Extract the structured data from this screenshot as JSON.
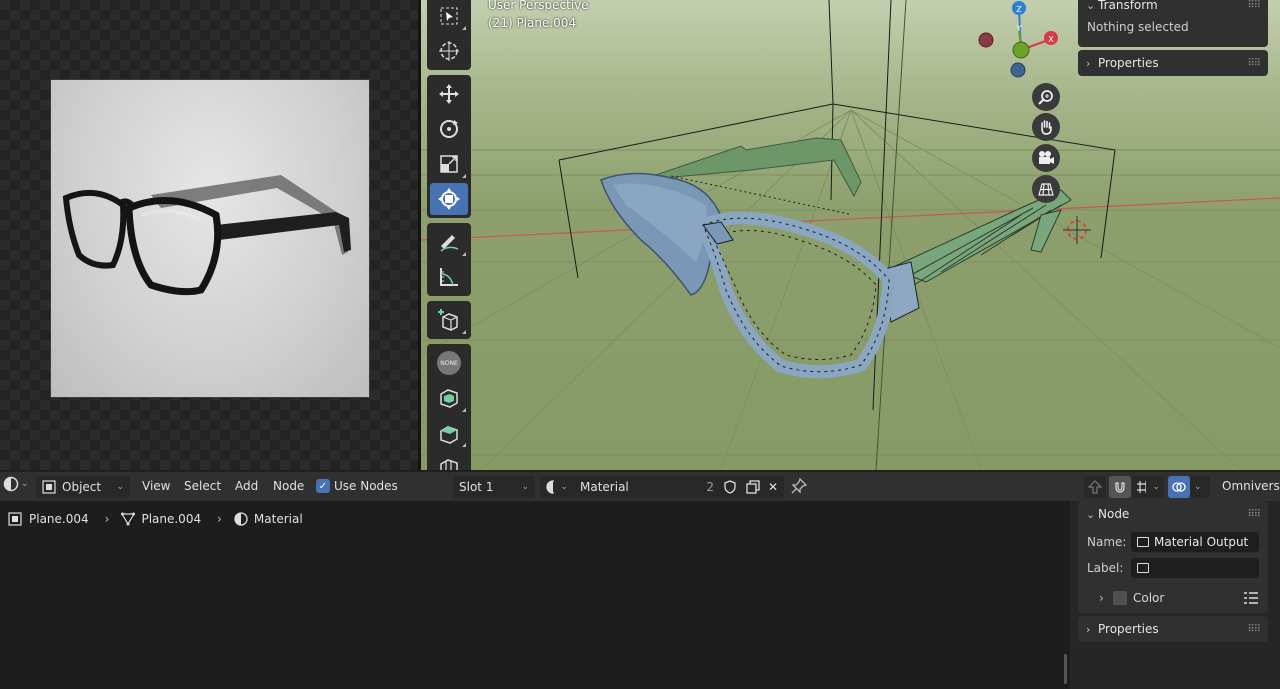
{
  "colors": {
    "accent": "#4772b3",
    "viewport_bg": "#869a66",
    "selected_mesh": "#7d9bb8",
    "unselected_mesh": "#6f9a70",
    "axis_x": "#d63b48",
    "axis_y": "#6aa22c",
    "axis_z": "#2e7fd6"
  },
  "image_editor": {
    "photo_subject": "eyeglasses-photo"
  },
  "viewport": {
    "view_name": "User Perspective",
    "object_info": "(21) Plane.004",
    "gizmo": {
      "z": "Z",
      "y": "Y",
      "x": "X"
    },
    "toolbar_tools": [
      "select-box-tool",
      "cursor-tool",
      "move-tool",
      "rotate-tool",
      "scale-tool",
      "transform-tool",
      "annotate-tool",
      "measure-tool",
      "add-cube-tool",
      "none-tool",
      "extrude-tool",
      "inset-tool",
      "loop-cut-tool"
    ],
    "none_label": "NONE",
    "nav_buttons": [
      "zoom-icon",
      "hand-pan-icon",
      "camera-icon",
      "grid-ortho-icon"
    ],
    "n_panel": {
      "transform_title": "Transform",
      "nothing_selected": "Nothing selected",
      "properties_title": "Properties"
    }
  },
  "node_header": {
    "mode": "Object",
    "menus": [
      "View",
      "Select",
      "Add",
      "Node"
    ],
    "use_nodes_label": "Use Nodes",
    "use_nodes_checked": true,
    "slot": "Slot 1",
    "material_name": "Material",
    "material_users": "2",
    "render_engine": "Omniverse"
  },
  "breadcrumb": {
    "object": "Plane.004",
    "mesh": "Plane.004",
    "material": "Material"
  },
  "node_sidebar": {
    "node_title": "Node",
    "name_label": "Name:",
    "name_value": "Material Output",
    "label_label": "Label:",
    "label_value": "",
    "color_label": "Color",
    "properties_title": "Properties"
  }
}
